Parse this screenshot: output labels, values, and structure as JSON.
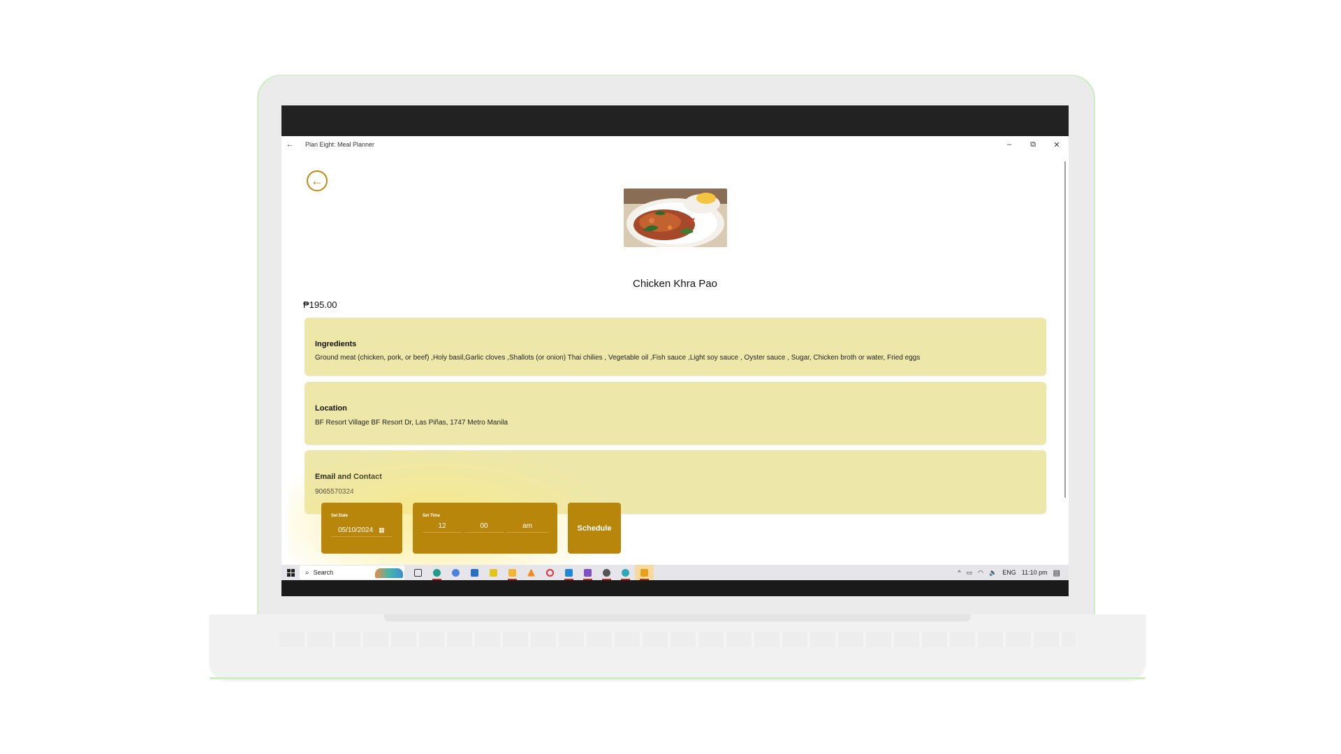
{
  "window": {
    "title": "Plan Eight: Meal Planner",
    "back_glyph": "←",
    "minimize_glyph": "–",
    "restore_glyph": "⧉",
    "close_glyph": "✕"
  },
  "page": {
    "back_glyph": "←",
    "dish_name": "Chicken Khra Pao",
    "price": "₱195.00"
  },
  "cards": {
    "ingredients": {
      "heading": "Ingredients",
      "text": "Ground meat (chicken, pork, or beef) ,Holy basil,Garlic cloves ,Shallots (or onion) Thai chilies , Vegetable oil ,Fish sauce ,Light soy sauce , Oyster sauce , Sugar, Chicken broth or water, Fried eggs"
    },
    "location": {
      "heading": "Location",
      "text": "BF Resort Village BF Resort Dr, Las Piñas, 1747 Metro Manila"
    },
    "contact": {
      "heading": "Email and Contact",
      "text": "9065570324"
    }
  },
  "schedule": {
    "date_label": "Set Date",
    "date_value": "05/10/2024",
    "calendar_glyph": "▦",
    "time_label": "Set Time",
    "hour": "12",
    "minute": "00",
    "period": "am",
    "button_label": "Schedule"
  },
  "taskbar": {
    "search_placeholder": "Search",
    "search_glyph": "⌕",
    "tray_chevron": "^",
    "tray_battery": "▭",
    "tray_wifi": "◠",
    "tray_volume": "🔈",
    "language": "ENG",
    "time": "11:10 pm",
    "notification_glyph": "▤"
  },
  "colors": {
    "accent": "#b8860b",
    "card_bg": "#ede7a9",
    "back_ring": "#c08a16"
  }
}
